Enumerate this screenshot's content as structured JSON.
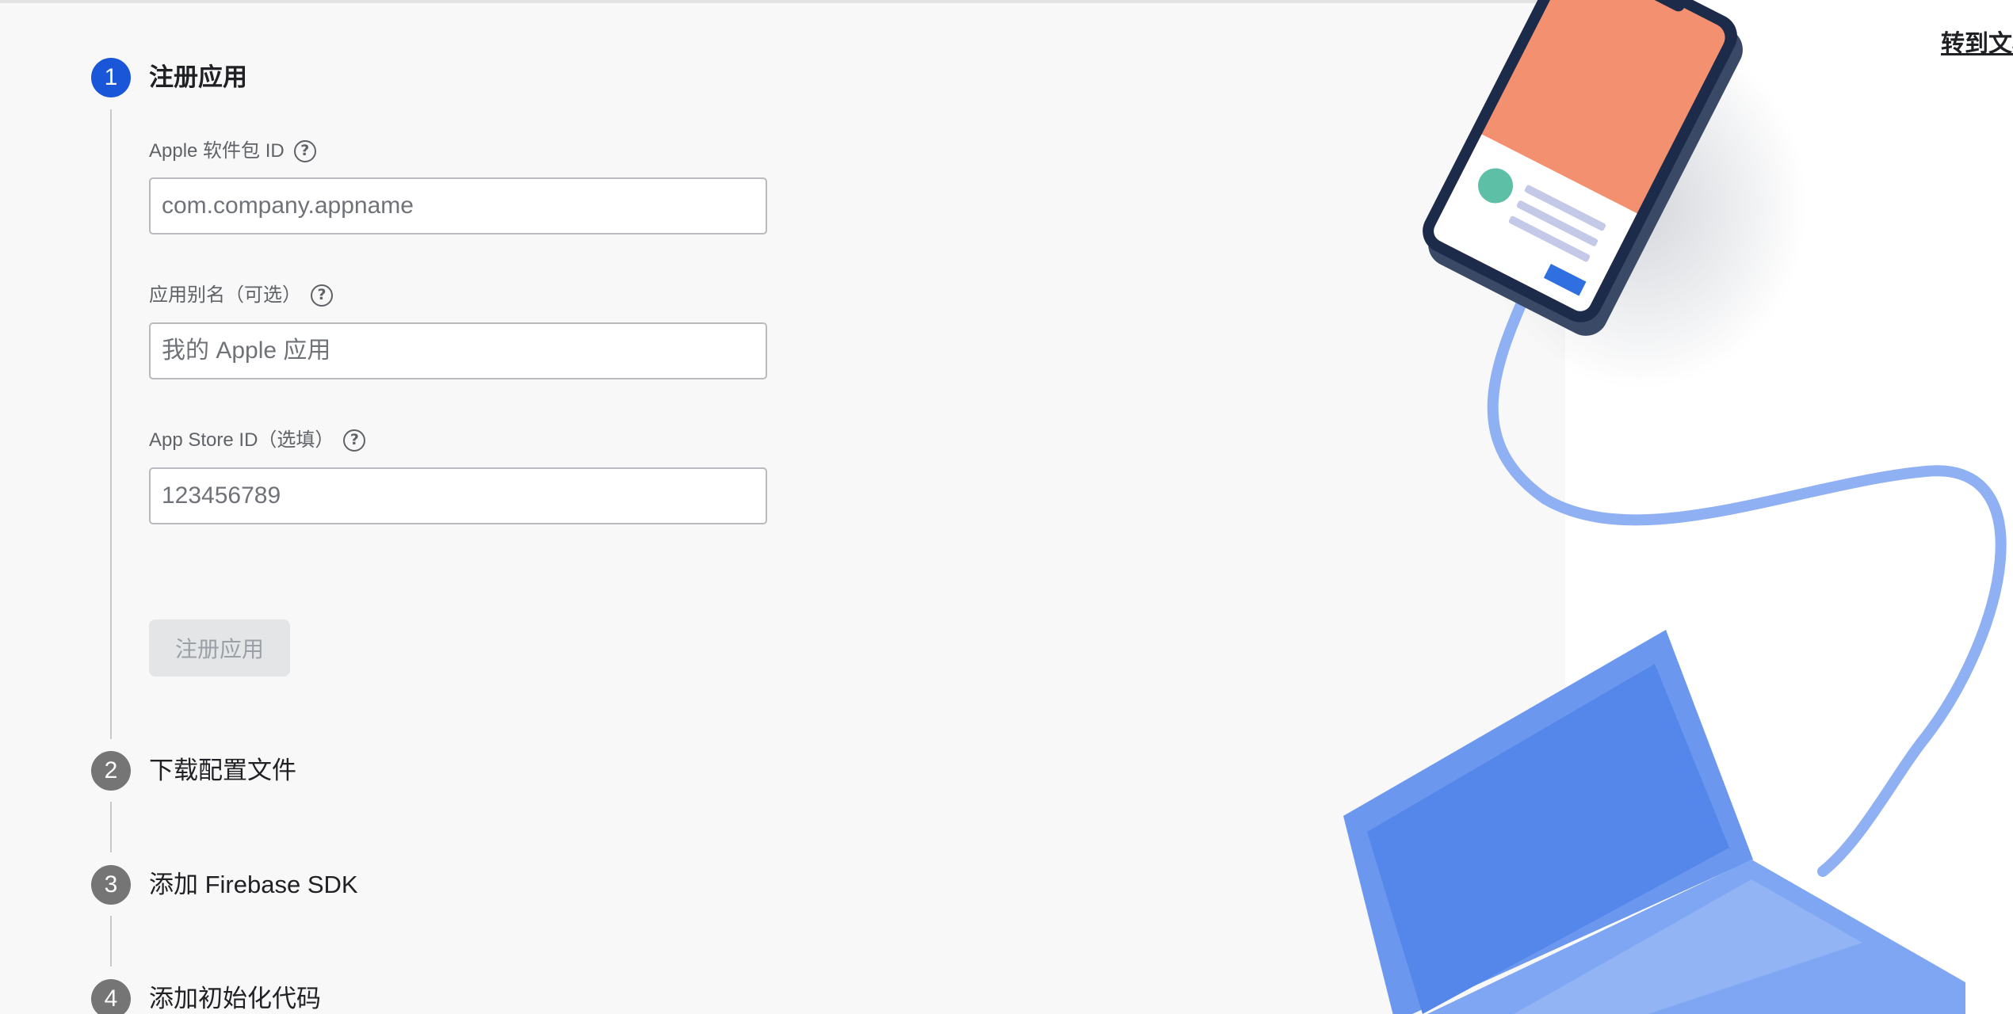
{
  "steps": [
    {
      "number": "1",
      "title": "注册应用",
      "state": "active"
    },
    {
      "number": "2",
      "title": "下载配置文件",
      "state": "pending"
    },
    {
      "number": "3",
      "title": "添加 Firebase SDK",
      "state": "pending"
    },
    {
      "number": "4",
      "title": "添加初始化代码",
      "state": "pending"
    }
  ],
  "form": {
    "bundle_id": {
      "label": "Apple 软件包 ID",
      "placeholder": "com.company.appname",
      "value": ""
    },
    "nickname": {
      "label": "应用别名（可选）",
      "placeholder": "我的 Apple 应用",
      "value": ""
    },
    "app_store_id": {
      "label": "App Store ID（选填）",
      "placeholder": "123456789",
      "value": ""
    },
    "help_glyph": "?",
    "register_button": "注册应用"
  },
  "docs_link": "转到文档",
  "colors": {
    "active_step": "#1a56d8",
    "inactive_step": "#757575",
    "laptop": "#6b97ef",
    "laptop_screen": "#5487e9",
    "phone_frame": "#1c2b4a",
    "phone_screen": "#f2906f",
    "avatar": "#5dbfa5",
    "cable": "#8fb0f2"
  }
}
